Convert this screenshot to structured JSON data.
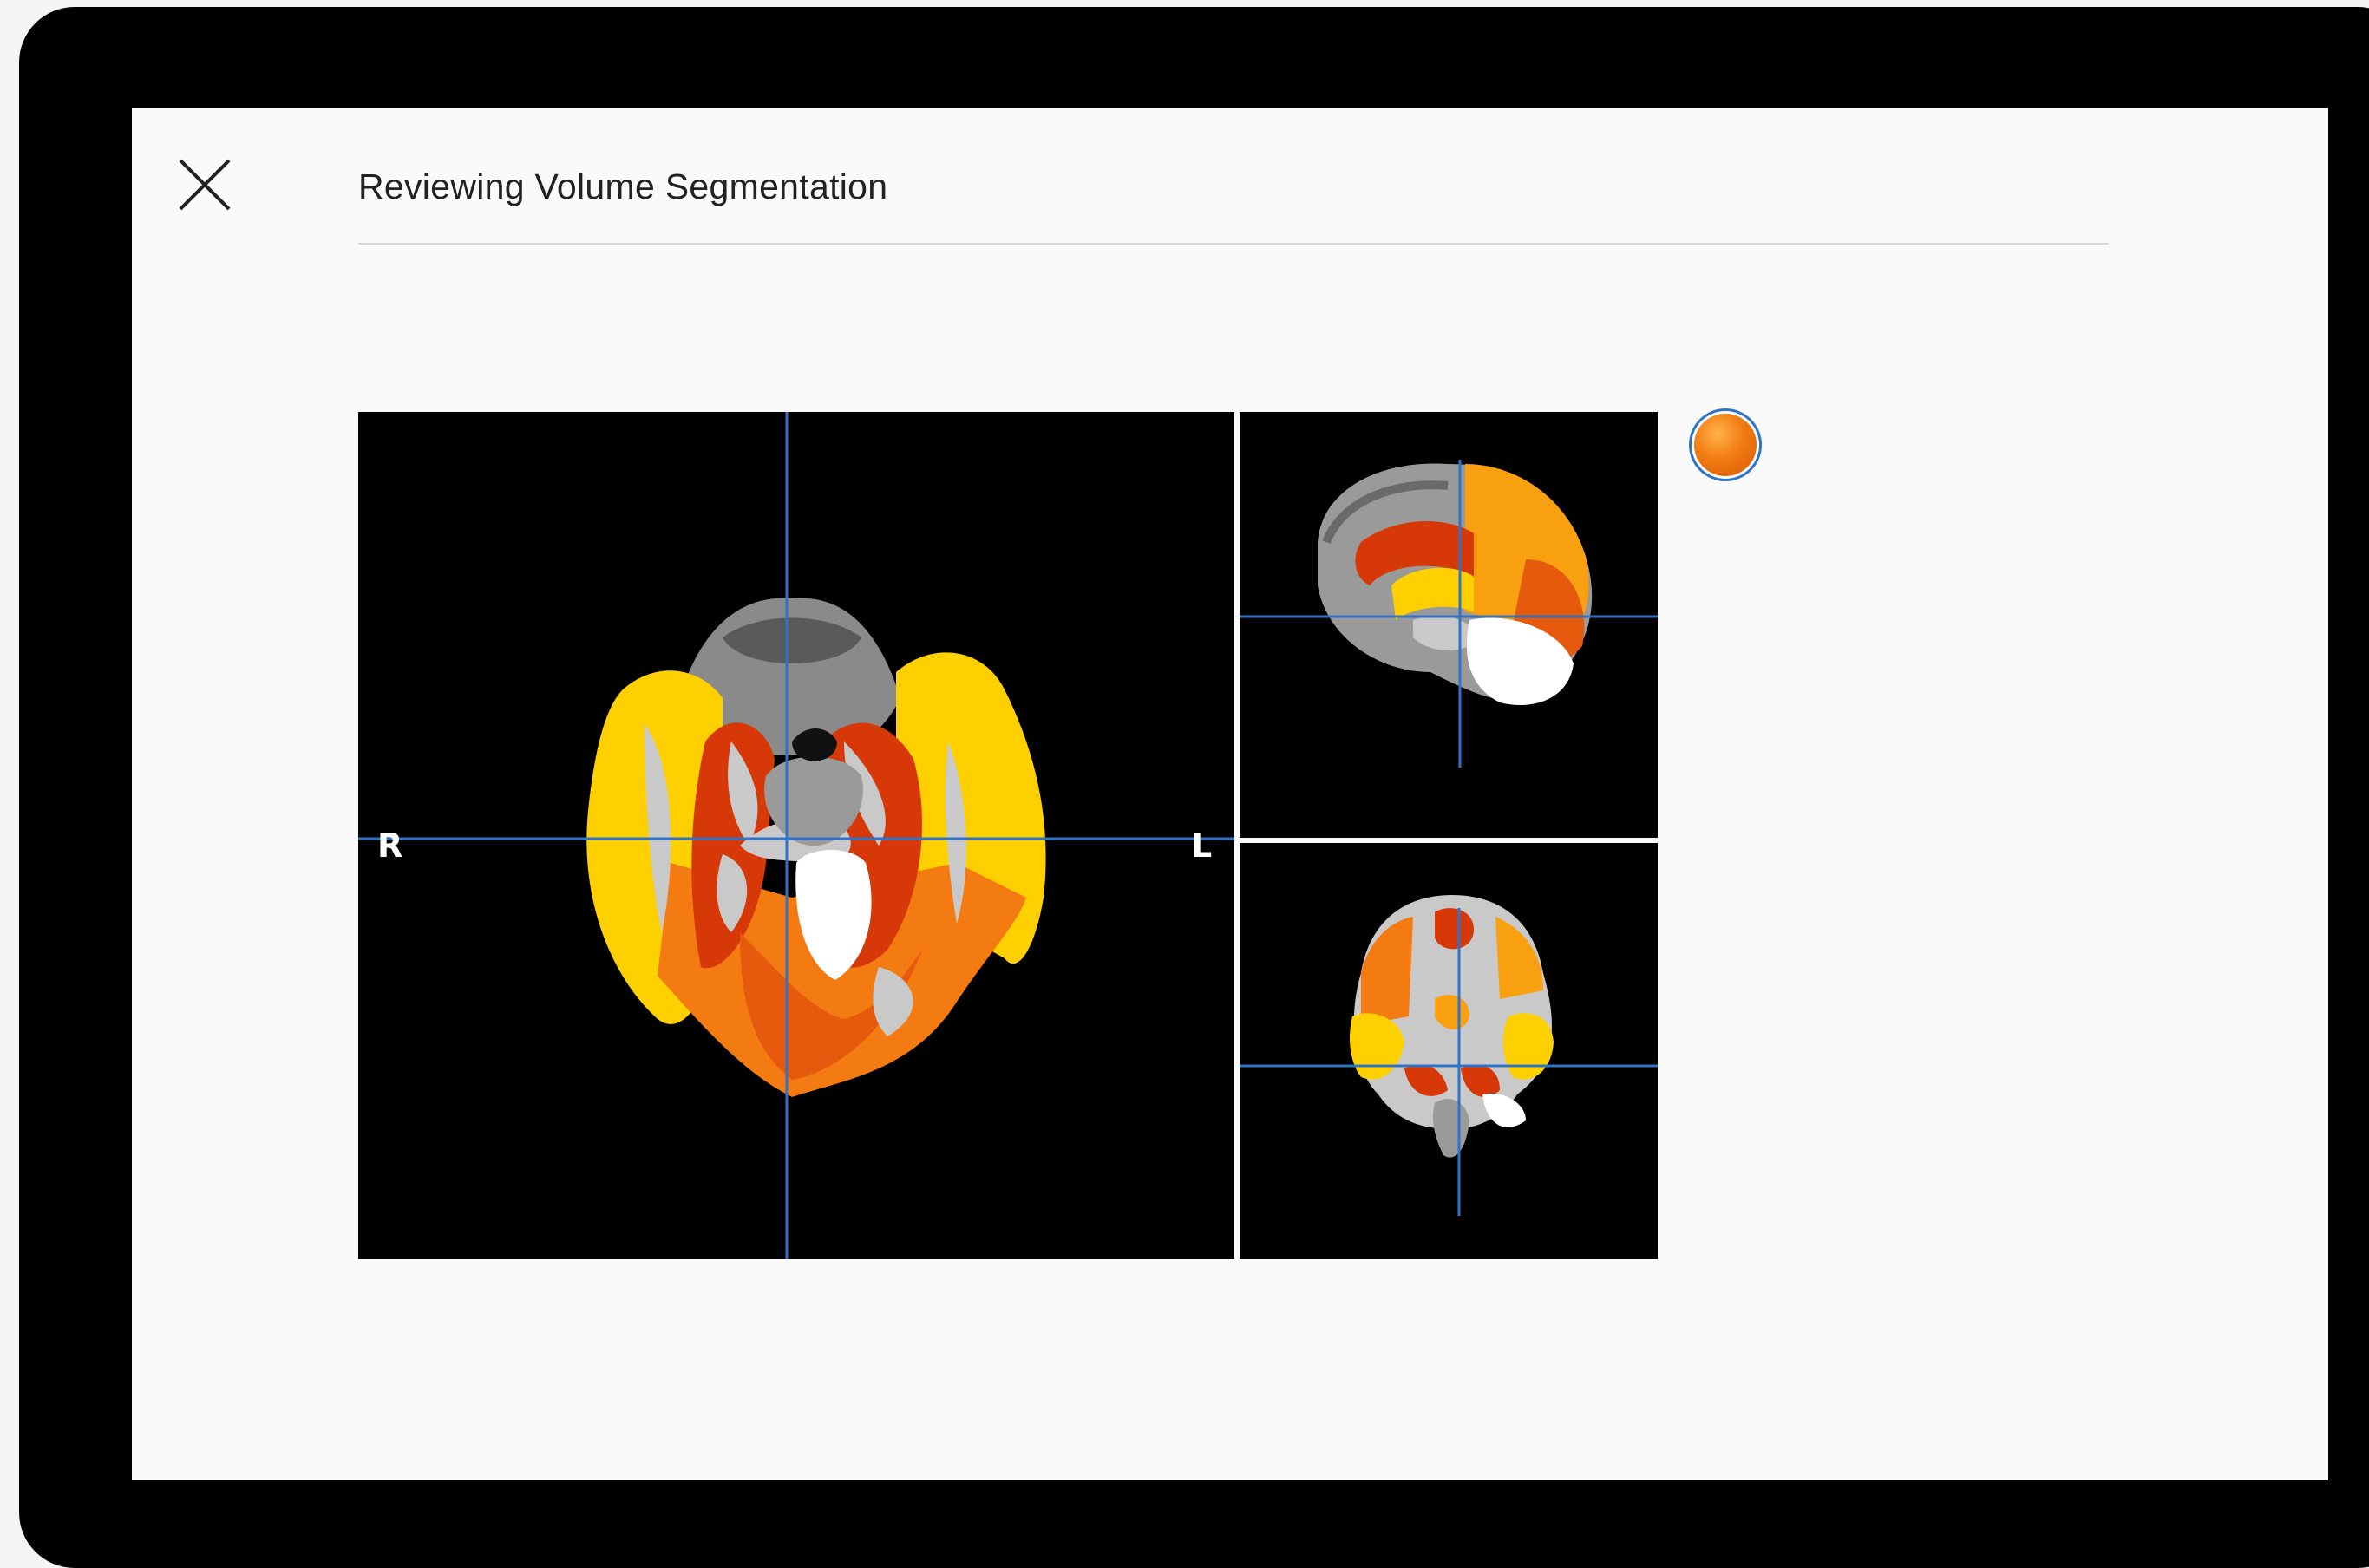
{
  "header": {
    "title": "Reviewing Volume Segmentation",
    "close_icon": "close-icon"
  },
  "viewers": {
    "axial": {
      "label_right": "R",
      "label_left": "L"
    }
  },
  "colors": {
    "device_frame": "#000000",
    "screen_background": "#fafafa",
    "crosshair": "#2f73c9",
    "overlay_yellow": "#ffd000",
    "overlay_orange": "#f47a12",
    "overlay_red": "#d73808",
    "overlay_white": "#ffffff",
    "tissue_gray": "#c9c9c9",
    "color_swatch": "#f27b12"
  }
}
